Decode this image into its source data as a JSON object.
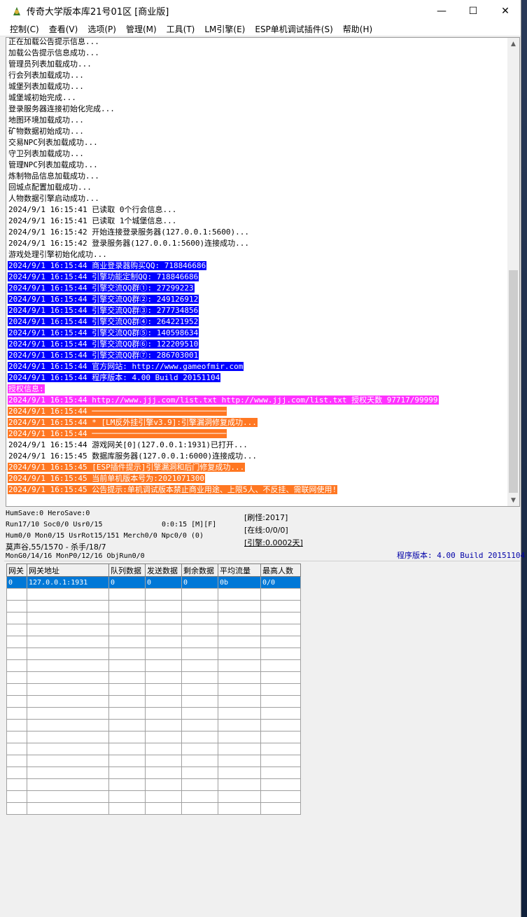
{
  "window": {
    "title": "传奇大学版本库21号01区 [商业版]",
    "minimize": "—",
    "maximize": "☐",
    "close": "✕"
  },
  "menu": [
    "控制(C)",
    "查看(V)",
    "选项(P)",
    "管理(M)",
    "工具(T)",
    "LM引擎(E)",
    "ESP单机调试插件(S)",
    "帮助(H)"
  ],
  "log": [
    {
      "text": "正在加载公告提示信息...",
      "hl": ""
    },
    {
      "text": "加载公告提示信息成功...",
      "hl": ""
    },
    {
      "text": "管理员列表加载成功...",
      "hl": ""
    },
    {
      "text": "行会列表加载成功...",
      "hl": ""
    },
    {
      "text": "城堡列表加载成功...",
      "hl": ""
    },
    {
      "text": "城堡城初始完成...",
      "hl": ""
    },
    {
      "text": "登录服务器连接初始化完成...",
      "hl": ""
    },
    {
      "text": "地图环境加载成功...",
      "hl": ""
    },
    {
      "text": "矿物数据初始成功...",
      "hl": ""
    },
    {
      "text": "交易NPC列表加载成功...",
      "hl": ""
    },
    {
      "text": "守卫列表加载成功...",
      "hl": ""
    },
    {
      "text": "管理NPC列表加载成功...",
      "hl": ""
    },
    {
      "text": "炼制物品信息加载成功...",
      "hl": ""
    },
    {
      "text": "回城点配置加载成功...",
      "hl": ""
    },
    {
      "text": "人物数据引擎启动成功...",
      "hl": ""
    },
    {
      "text": "2024/9/1 16:15:41 已读取 0个行会信息...",
      "hl": ""
    },
    {
      "text": "2024/9/1 16:15:41 已读取 1个城堡信息...",
      "hl": ""
    },
    {
      "text": "2024/9/1 16:15:42 开始连接登录服务器(127.0.0.1:5600)...",
      "hl": ""
    },
    {
      "text": "2024/9/1 16:15:42 登录服务器(127.0.0.1:5600)连接成功...",
      "hl": ""
    },
    {
      "text": "游戏处理引擎初始化成功...",
      "hl": ""
    },
    {
      "text": "2024/9/1 16:15:44 商业登录器购买QQ: 718846686",
      "hl": "blue"
    },
    {
      "text": "2024/9/1 16:15:44 引擎功能定制QQ: 718846686",
      "hl": "blue"
    },
    {
      "text": "2024/9/1 16:15:44 引擎交流QQ群①: 27299223",
      "hl": "blue"
    },
    {
      "text": "2024/9/1 16:15:44 引擎交流QQ群②: 249126912",
      "hl": "blue"
    },
    {
      "text": "2024/9/1 16:15:44 引擎交流QQ群③: 277734856",
      "hl": "blue"
    },
    {
      "text": "2024/9/1 16:15:44 引擎交流QQ群④: 264221952",
      "hl": "blue"
    },
    {
      "text": "2024/9/1 16:15:44 引擎交流QQ群⑤: 140598634",
      "hl": "blue"
    },
    {
      "text": "2024/9/1 16:15:44 引擎交流QQ群⑥: 122209510",
      "hl": "blue"
    },
    {
      "text": "2024/9/1 16:15:44 引擎交流QQ群⑦: 286703001",
      "hl": "blue"
    },
    {
      "text": "2024/9/1 16:15:44 官方网站: http://www.gameofmir.com",
      "hl": "blue"
    },
    {
      "text": "2024/9/1 16:15:44 程序版本: 4.00 Build 20151104",
      "hl": "blue"
    },
    {
      "text": "授权信息:",
      "hl": "magenta"
    },
    {
      "text": "2024/9/1 16:15:44 http://www.jjj.com/list.txt http://www.jjj.com/list.txt 授权天数 97717/99999",
      "hl": "magenta"
    },
    {
      "text": "2024/9/1 16:15:44 ─────────────────────────────",
      "hl": "orange"
    },
    {
      "text": "2024/9/1 16:15:44 * [LM反外挂引擎v3.9]:引擎漏洞修复成功...",
      "hl": "orange"
    },
    {
      "text": "2024/9/1 16:15:44 ─────────────────────────────",
      "hl": "orange"
    },
    {
      "text": "2024/9/1 16:15:44 游戏网关[0](127.0.0.1:1931)已打开...",
      "hl": ""
    },
    {
      "text": "2024/9/1 16:15:45 数据库服务器(127.0.0.1:6000)连接成功...",
      "hl": ""
    },
    {
      "text": "2024/9/1 16:15:45 [ESP插件提示]引擎漏洞和后门修复成功...",
      "hl": "orange"
    },
    {
      "text": "2024/9/1 16:15:45 当前单机版本号为:2021071300",
      "hl": "orange"
    },
    {
      "text": "2024/9/1 16:15:45 公告提示:单机调试版本禁止商业用途、上限5人、不反挂、需联网使用!",
      "hl": "orange"
    }
  ],
  "status": {
    "humsave": "HumSave:0 HeroSave:0",
    "run": "Run17/10 Soc0/0 Usr0/15",
    "timer": "0:0:15 [M][F]",
    "hum": "Hum0/0 Mon0/15 UsrRot15/151 Merch0/0 Npc0/0 (0)",
    "map": "莫声谷,55/1570 - 杀手/18/7",
    "mon": "MonG0/14/16 MonP0/12/16 ObjRun0/0",
    "refresh": "[刷怪:2017]",
    "online": "[在线:0/0/0]",
    "engine": "[引擎:0.0002天]",
    "version": "程序版本: 4.00 Build 20151104"
  },
  "gateway_table": {
    "headers": [
      "网关",
      "网关地址",
      "队列数据",
      "发送数据",
      "剩余数据",
      "平均流量",
      "最高人数"
    ],
    "rows": [
      [
        "0",
        "127.0.0.1:1931",
        "0",
        "0",
        "0",
        "0b",
        "0/0"
      ]
    ],
    "empty_rows": 19
  }
}
